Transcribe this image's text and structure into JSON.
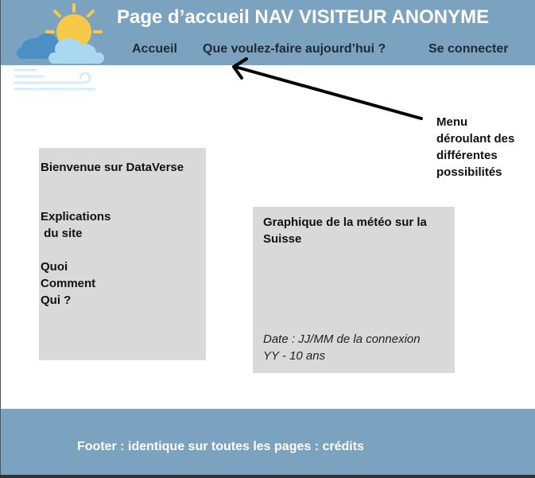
{
  "header": {
    "title": "Page d’accueil NAV VISITEUR ANONYME",
    "logo_icon": "weather-sun-cloud-wind-icon",
    "nav": [
      {
        "label": "Accueil"
      },
      {
        "label": "Que voulez-faire aujourd’hui ?"
      },
      {
        "label": "Se connecter"
      }
    ]
  },
  "annotation": {
    "lines": [
      "Menu",
      "déroulant des",
      "différentes",
      "possibilités"
    ],
    "arrow_icon": "arrow-left-icon"
  },
  "welcome": {
    "title": "Bienvenue sur DataVerse",
    "lines": [
      "Explications",
      " du site",
      "",
      "Quoi",
      "Comment",
      "Qui ?"
    ]
  },
  "weather": {
    "title_lines": [
      "Graphique de la météo sur la",
      "Suisse"
    ],
    "date_lines": [
      "Date : JJ/MM de la connexion",
      "YY - 10 ans"
    ]
  },
  "footer": {
    "text": "Footer : identique sur toutes les pages : crédits"
  },
  "colors": {
    "header_bg": "#7ba3c0",
    "box_bg": "#d9d9d9",
    "sun": "#f7c948",
    "cloud": "#a9d8f0"
  }
}
